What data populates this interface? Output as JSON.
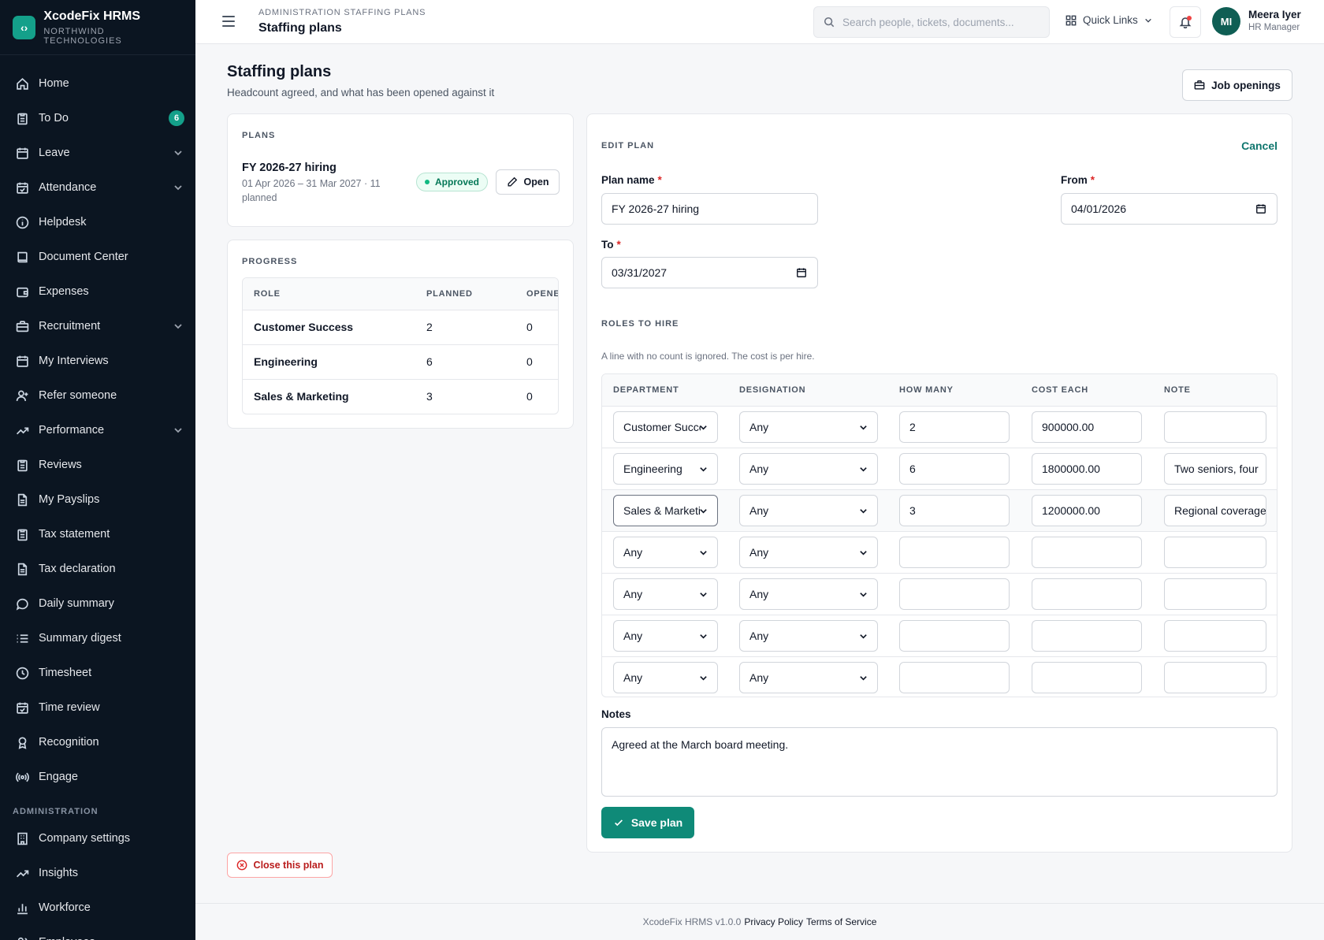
{
  "app": {
    "name": "XcodeFix HRMS",
    "org": "NORTHWIND TECHNOLOGIES",
    "logo_glyph": "‹›",
    "accent": "#14a08a"
  },
  "sidebar": {
    "items": [
      {
        "label": "Home",
        "icon": "home-icon"
      },
      {
        "label": "To Do",
        "icon": "clipboard-icon",
        "badge": "6"
      },
      {
        "label": "Leave",
        "icon": "calendar-icon",
        "expandable": true
      },
      {
        "label": "Attendance",
        "icon": "calendar-check-icon",
        "expandable": true
      },
      {
        "label": "Helpdesk",
        "icon": "info-icon"
      },
      {
        "label": "Document Center",
        "icon": "book-icon"
      },
      {
        "label": "Expenses",
        "icon": "wallet-icon"
      },
      {
        "label": "Recruitment",
        "icon": "briefcase-icon",
        "expandable": true
      },
      {
        "label": "My Interviews",
        "icon": "calendar-icon"
      },
      {
        "label": "Refer someone",
        "icon": "user-plus-icon"
      },
      {
        "label": "Performance",
        "icon": "trend-icon",
        "expandable": true
      },
      {
        "label": "Reviews",
        "icon": "clipboard-icon"
      },
      {
        "label": "My Payslips",
        "icon": "file-icon"
      },
      {
        "label": "Tax statement",
        "icon": "clipboard-icon"
      },
      {
        "label": "Tax declaration",
        "icon": "file-icon"
      },
      {
        "label": "Daily summary",
        "icon": "message-icon"
      },
      {
        "label": "Summary digest",
        "icon": "list-icon"
      },
      {
        "label": "Timesheet",
        "icon": "clock-icon"
      },
      {
        "label": "Time review",
        "icon": "calendar-check-icon"
      },
      {
        "label": "Recognition",
        "icon": "award-icon"
      },
      {
        "label": "Engage",
        "icon": "broadcast-icon"
      }
    ],
    "section_admin": "ADMINISTRATION",
    "admin_items": [
      {
        "label": "Company settings",
        "icon": "building-icon"
      },
      {
        "label": "Insights",
        "icon": "trend-icon"
      },
      {
        "label": "Workforce",
        "icon": "bar-chart-icon"
      },
      {
        "label": "Employees",
        "icon": "users-icon"
      }
    ]
  },
  "topbar": {
    "breadcrumb": "ADMINISTRATION STAFFING PLANS",
    "title": "Staffing plans",
    "search_placeholder": "Search people, tickets, documents...",
    "quick_links": "Quick Links",
    "user_initials": "MI",
    "user_name": "Meera Iyer",
    "user_role": "HR Manager"
  },
  "page": {
    "title": "Staffing plans",
    "subtitle": "Headcount agreed, and what has been opened against it",
    "job_openings_button": "Job openings",
    "close_plan_button": "Close this plan"
  },
  "plans": {
    "label": "PLANS",
    "items": [
      {
        "name": "FY 2026-27 hiring",
        "meta": "01 Apr 2026 – 31 Mar 2027 · 11 planned",
        "status": "Approved",
        "open_label": "Open"
      }
    ]
  },
  "progress": {
    "label": "PROGRESS",
    "columns": [
      "ROLE",
      "PLANNED",
      "OPENED"
    ],
    "rows": [
      {
        "role": "Customer Success",
        "planned": "2",
        "opened": "0"
      },
      {
        "role": "Engineering",
        "planned": "6",
        "opened": "0"
      },
      {
        "role": "Sales & Marketing",
        "planned": "3",
        "opened": "0"
      }
    ]
  },
  "edit": {
    "label": "EDIT PLAN",
    "cancel": "Cancel",
    "plan_name_label": "Plan name",
    "plan_name_value": "FY 2026-27 hiring",
    "from_label": "From",
    "from_value": "04/01/2026",
    "to_label": "To",
    "to_value": "03/31/2027",
    "roles_label": "ROLES TO HIRE",
    "roles_hint": "A line with no count is ignored. The cost is per hire.",
    "columns": [
      "DEPARTMENT",
      "DESIGNATION",
      "HOW MANY",
      "COST EACH",
      "NOTE"
    ],
    "rows": [
      {
        "department": "Customer Success",
        "designation": "Any",
        "count": "2",
        "cost": "900000.00",
        "note": ""
      },
      {
        "department": "Engineering",
        "designation": "Any",
        "count": "6",
        "cost": "1800000.00",
        "note": "Two seniors, four"
      },
      {
        "department": "Sales & Marketing",
        "designation": "Any",
        "count": "3",
        "cost": "1200000.00",
        "note": "Regional coverage"
      },
      {
        "department": "Any",
        "designation": "Any",
        "count": "",
        "cost": "",
        "note": ""
      },
      {
        "department": "Any",
        "designation": "Any",
        "count": "",
        "cost": "",
        "note": ""
      },
      {
        "department": "Any",
        "designation": "Any",
        "count": "",
        "cost": "",
        "note": ""
      },
      {
        "department": "Any",
        "designation": "Any",
        "count": "",
        "cost": "",
        "note": ""
      }
    ],
    "notes_label": "Notes",
    "notes_value": "Agreed at the March board meeting.",
    "save_button": "Save plan"
  },
  "footer": {
    "version": "XcodeFix HRMS v1.0.0",
    "privacy": "Privacy Policy",
    "terms": "Terms of Service"
  }
}
